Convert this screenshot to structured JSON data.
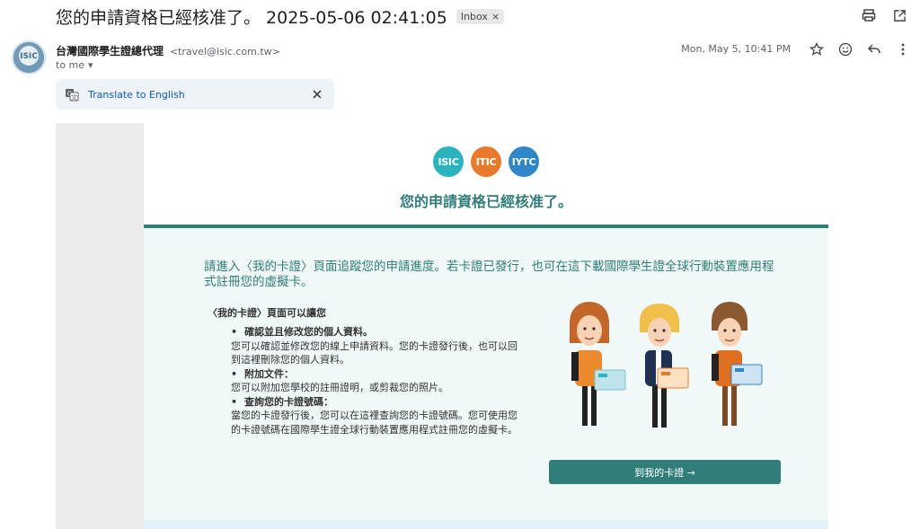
{
  "header": {
    "subject": "您的申請資格已經核准了。 2025-05-06 02:41:05",
    "label_chip": "Inbox"
  },
  "message": {
    "sender_name": "台灣國際學生證總代理",
    "sender_email": "<travel@isic.com.tw>",
    "recipient": "to me",
    "date": "Mon, May 5, 10:41 PM"
  },
  "translate_bar": {
    "link": "Translate to English"
  },
  "email": {
    "logos": [
      {
        "text": "ISIC",
        "color": "#2bb3c0"
      },
      {
        "text": "ITIC",
        "color": "#ea7a2b"
      },
      {
        "text": "IYTC",
        "color": "#2f86c9"
      }
    ],
    "headline": "您的申請資格已經核准了。",
    "intro": "請進入〈我的卡證〉頁面追蹤您的申請進度。若卡證已發行，也可在這下載國際學生證全球行動裝置應用程式註冊您的虛擬卡。",
    "section_title": "〈我的卡證〉頁面可以讓您",
    "bullets": [
      {
        "title": "確認並且修改您的個人資料。",
        "desc": "您可以確認並修改您的線上申請資料。您的卡證發行後，也可以回到這裡刪除您的個人資料。"
      },
      {
        "title": "附加文件：",
        "desc": "您可以附加您學校的註冊證明，或剪裁您的照片。"
      },
      {
        "title": "查詢您的卡證號碼：",
        "desc": "當您的卡證發行後，您可以在這裡查詢您的卡證號碼。您可使用您的卡證號碼在國際學生證全球行動裝置應用程式註冊您的虛擬卡。"
      }
    ],
    "cta": "到我的卡證 →"
  },
  "colors": {
    "teal": "#2f7e79",
    "panel": "#f1f9f8",
    "link": "#0b57d0"
  }
}
